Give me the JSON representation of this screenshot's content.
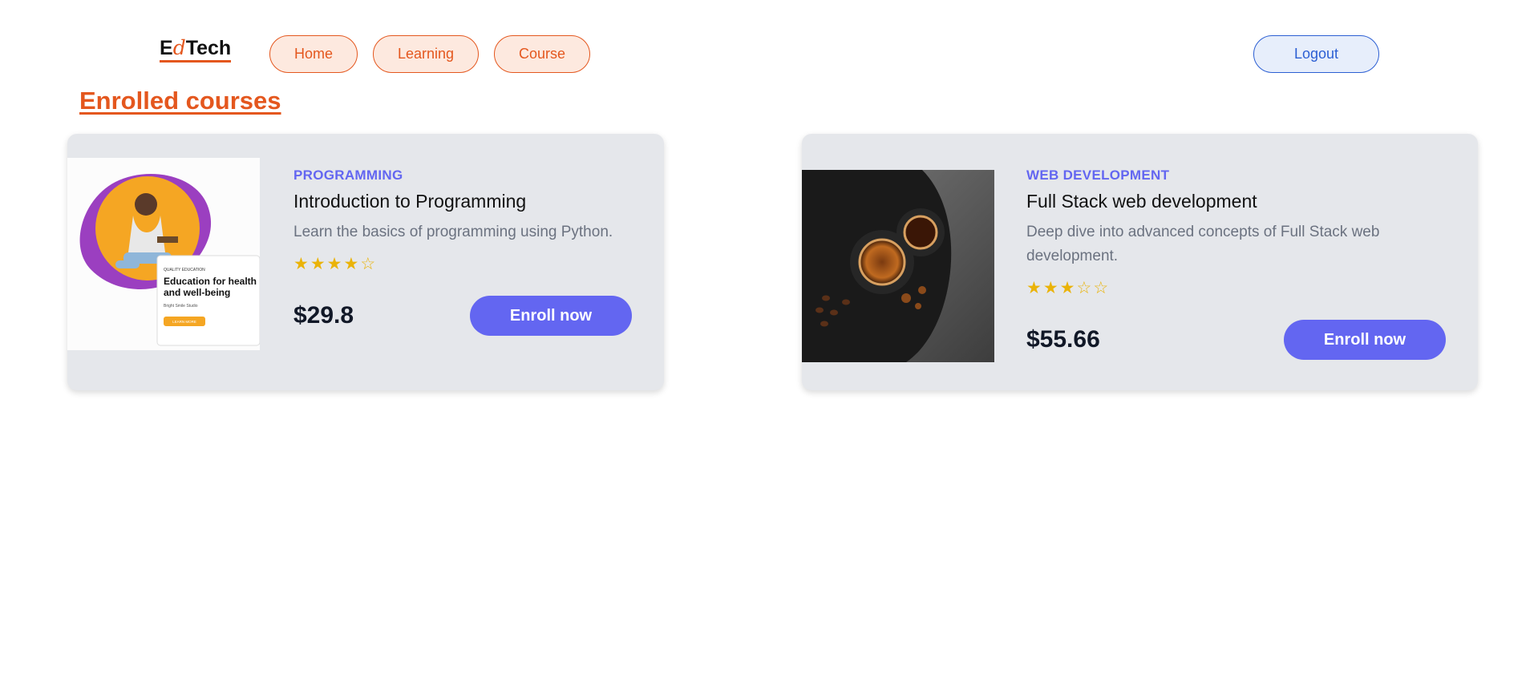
{
  "header": {
    "logo": {
      "prefix": "E",
      "middle": "d",
      "suffix": "Tech"
    },
    "nav": [
      {
        "label": "Home"
      },
      {
        "label": "Learning"
      },
      {
        "label": "Course"
      }
    ],
    "logout_label": "Logout"
  },
  "page": {
    "title": "Enrolled courses"
  },
  "courses": [
    {
      "category": "PROGRAMMING",
      "title": "Introduction to Programming",
      "description": "Learn the basics of programming using Python.",
      "rating": 4,
      "rating_max": 5,
      "price": "$29.8",
      "button_label": "Enroll now",
      "image": {
        "kicker": "QUALITY EDUCATION",
        "headline_line1": "Education for health",
        "headline_line2": "and well-being",
        "subtext": "Bright Smile Studio",
        "button": "LEARN MORE"
      }
    },
    {
      "category": "WEB DEVELOPMENT",
      "title": "Full Stack web development",
      "description": "Deep dive into advanced concepts of Full Stack web development.",
      "rating": 3,
      "rating_max": 5,
      "price": "$55.66",
      "button_label": "Enroll now",
      "image": {}
    }
  ],
  "colors": {
    "accent_orange": "#e4571e",
    "accent_indigo": "#6366f1",
    "logout_blue": "#2c5fd3",
    "card_bg": "#e5e7eb",
    "star": "#eab308"
  },
  "icons": {
    "star_filled": "star-filled-icon",
    "star_empty": "star-empty-icon"
  }
}
